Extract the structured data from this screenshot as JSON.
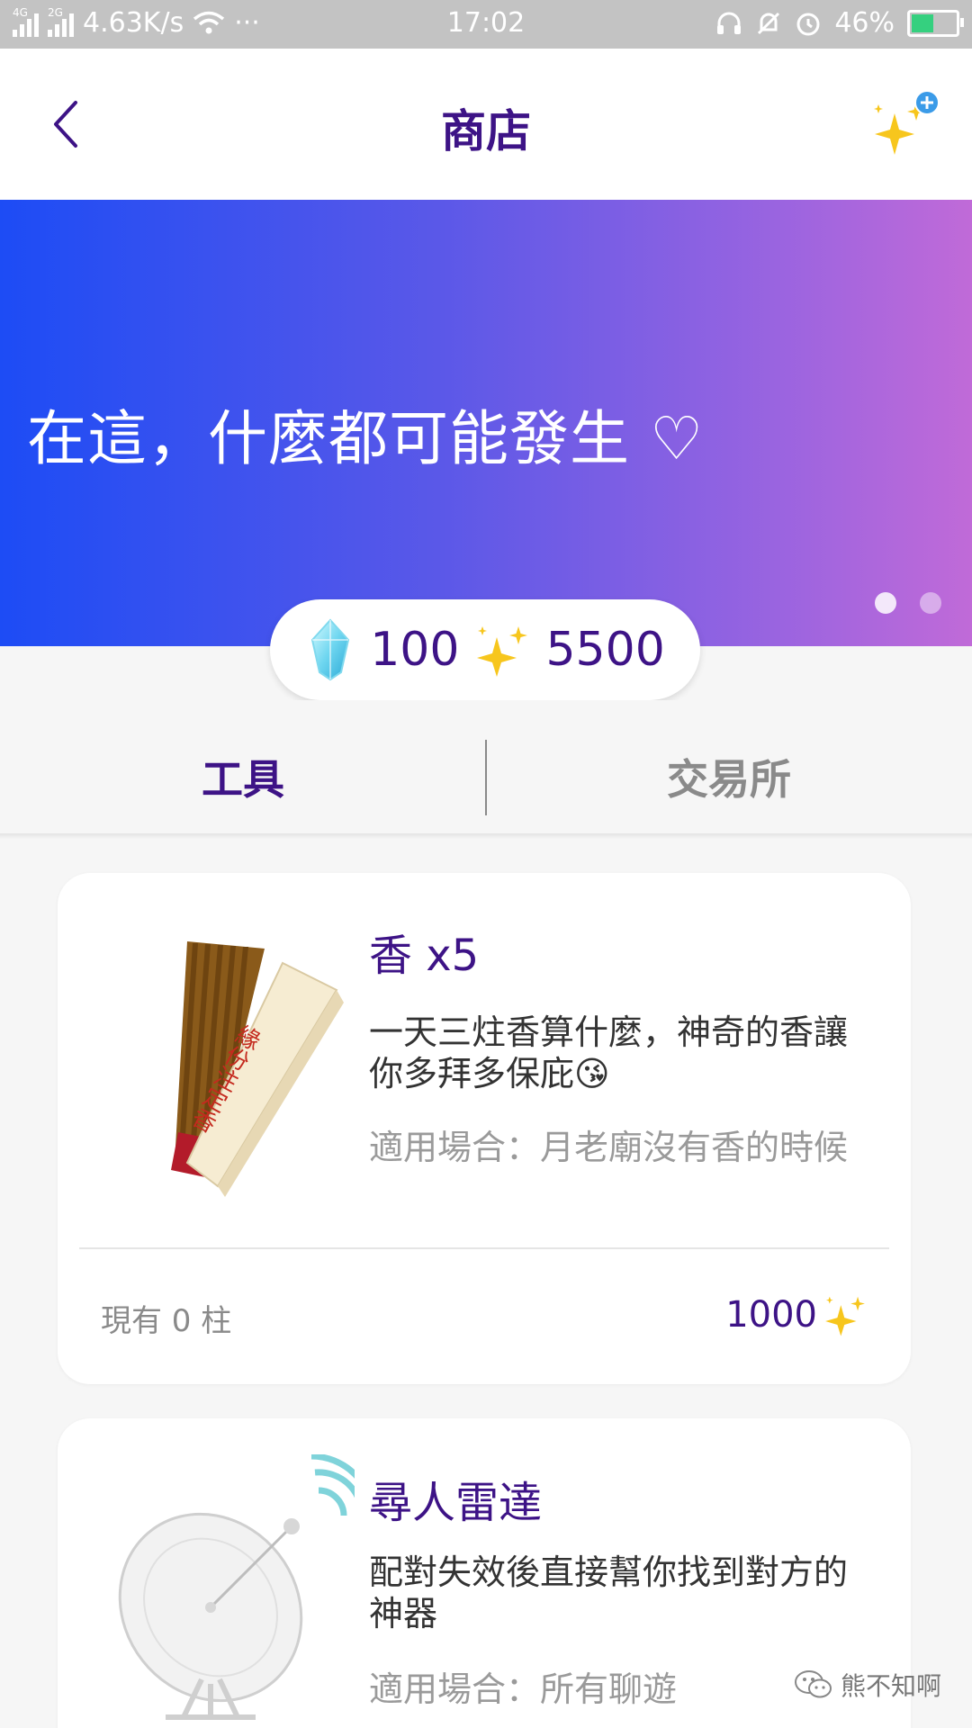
{
  "status_bar": {
    "signal_1": "4G",
    "signal_2": "2G",
    "net_speed": "4.63K/s",
    "more": "···",
    "time": "17:02",
    "battery": "46%",
    "battery_level": 0.46
  },
  "header": {
    "title": "商店",
    "back_icon": "chevron-left-icon",
    "sparkle_icon": "sparkles-plus-icon"
  },
  "banner": {
    "text": "在這，什麼都可能發生 ♡",
    "active_slide": 1,
    "slide_count": 2
  },
  "balance": {
    "crystal": "100",
    "sparkles": "5500"
  },
  "tabs": [
    {
      "label": "工具",
      "active": true
    },
    {
      "label": "交易所",
      "active": false
    }
  ],
  "items": [
    {
      "name": "香 x5",
      "description": "一天三炷香算什麼，神奇的香讓你多拜多保庇😘",
      "usage": "適用場合：月老廟沒有香的時候",
      "owned": "現有 0 柱",
      "price": "1000",
      "box_text": "緣份注定香",
      "image": "incense-icon"
    },
    {
      "name": "尋人雷達",
      "description": "配對失效後直接幫你找到對方的神器",
      "usage": "適用場合：所有聊遊",
      "image": "radar-dish-icon"
    }
  ],
  "watermark": "熊不知啊",
  "colors": {
    "accent": "#3d1386",
    "banner_start": "#1d4cf5",
    "banner_end": "#c06ad8",
    "status_bar": "#c3c3c3"
  }
}
